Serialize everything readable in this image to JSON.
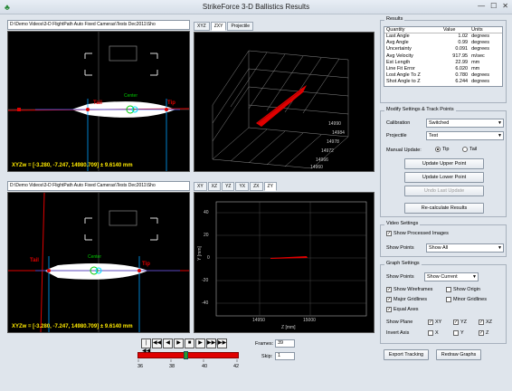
{
  "window": {
    "title": "StrikeForce 3-D Ballistics Results",
    "min": "—",
    "max": "☐",
    "close": "✕"
  },
  "cameras": [
    {
      "title": "D:\\Demo Videos\\3-D FlightPath Auto Fixed Cameras\\Tests Dec2011\\Sho",
      "readout": "XYZw = [-3.280, -7.247, 14980.709]  ± 9.6140 mm",
      "labels": {
        "tail": "Tail",
        "tip": "Tip",
        "center": "Center"
      }
    },
    {
      "title": "D:\\Demo Videos\\3-D FlightPath Auto Fixed Cameras\\Tests Dec2011\\Sho",
      "readout": "XYZw = [-3.280, -7.247, 14980.709]  ± 9.6140 mm",
      "labels": {
        "tail": "Tail",
        "tip": "Tip",
        "center": "Center"
      }
    }
  ],
  "top_tabs": [
    "XYZ",
    "ZXY",
    "Projectile"
  ],
  "bottom_tabs": [
    "XY",
    "XZ",
    "YZ",
    "YX",
    "ZX",
    "ZY"
  ],
  "plot3d": {
    "ticks": [
      "14990",
      "14984",
      "14978",
      "14972",
      "14966",
      "14960"
    ]
  },
  "plot2d": {
    "y_ticks": [
      "40",
      "20",
      "0",
      "-20",
      "-40"
    ],
    "x_ticks": [
      "14950",
      "15000"
    ],
    "ylabel": "Y [mm]",
    "xlabel": "Z [mm]"
  },
  "transport": {
    "buttons": [
      "|◀◀",
      "◀◀",
      "◀",
      "▶",
      "■",
      "▶",
      "▶▶|",
      "▶▶"
    ],
    "slider_ticks": [
      "36",
      "38",
      "40",
      "42"
    ]
  },
  "frames": {
    "label": "Frames:",
    "value": "39",
    "skip_label": "Skip:",
    "skip_value": "1"
  },
  "results": {
    "label": "Results",
    "headers": [
      "Quantity",
      "Value",
      "Units"
    ],
    "rows": [
      [
        "Last Angle",
        "1.02",
        "degrees"
      ],
      [
        "Avg Angle",
        "0.99",
        "degrees"
      ],
      [
        "Uncertainty",
        "0.091",
        "degrees"
      ],
      [
        "Avg Velocity",
        "917.95",
        "m/sec"
      ],
      [
        "Est Length",
        "22.99",
        "mm"
      ],
      [
        "Line Fit Error",
        "6.020",
        "mm"
      ],
      [
        "Lost Angle To Z",
        "0.780",
        "degrees"
      ],
      [
        "Shot Angle to Z",
        "6.244",
        "degrees"
      ]
    ]
  },
  "modify": {
    "label": "Modify Settings & Track Points",
    "calibration_label": "Calibration",
    "calibration_value": "Switched",
    "projectile_label": "Projectile",
    "projectile_value": "Test",
    "manual_update_label": "Manual Update:",
    "tip_label": "Tip",
    "tail_label": "Tail",
    "update_upper": "Update Upper Point",
    "update_lower": "Update Lower Point",
    "undo": "Undo Last Update",
    "recalc": "Re-calculate Results"
  },
  "video": {
    "label": "Video Settings",
    "show_processed": "Show Processed Images",
    "show_points_label": "Show Points",
    "show_points_value": "Show All"
  },
  "graph": {
    "label": "Graph Settings",
    "show_points_label": "Show Points",
    "show_points_value": "Show Current",
    "show_wireframes": "Show Wireframes",
    "show_origin": "Show Origin",
    "major_gridlines": "Major Gridlines",
    "minor_gridlines": "Minor Gridlines",
    "equal_axes": "Equal Axes",
    "show_plane_label": "Show Plane",
    "plane_xy": "XY",
    "plane_yz": "YZ",
    "plane_xz": "XZ",
    "invert_label": "Invert Axis",
    "inv_x": "X",
    "inv_y": "Y",
    "inv_z": "Z"
  },
  "footer": {
    "export": "Export Tracking",
    "redraw": "Redraw Graphs"
  },
  "colors": {
    "accent_red": "#e00000",
    "cyan": "#00e0ff",
    "readout": "#ffea00"
  }
}
